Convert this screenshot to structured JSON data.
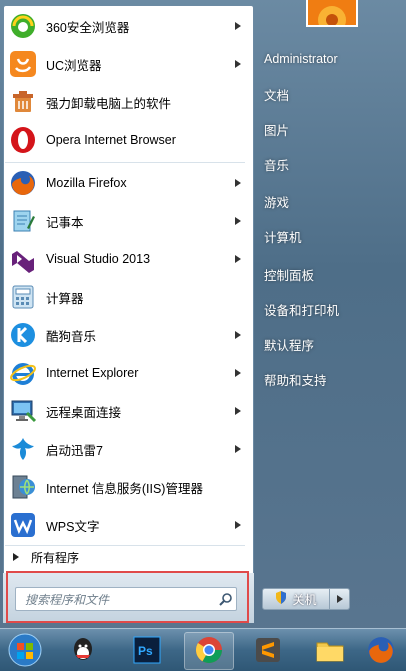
{
  "start_menu": {
    "pinned_apps": [
      {
        "label": "360安全浏览器",
        "icon": "360-browser-icon",
        "has_arrow": true
      },
      {
        "label": "UC浏览器",
        "icon": "uc-browser-icon",
        "has_arrow": true
      },
      {
        "label": "强力卸载电脑上的软件",
        "icon": "uninstaller-icon",
        "has_arrow": false
      },
      {
        "label": "Opera Internet Browser",
        "icon": "opera-icon",
        "has_arrow": false
      }
    ],
    "recent_apps": [
      {
        "label": "Mozilla Firefox",
        "icon": "firefox-icon",
        "has_arrow": true
      },
      {
        "label": "记事本",
        "icon": "notepad-icon",
        "has_arrow": true
      },
      {
        "label": "Visual Studio 2013",
        "icon": "visual-studio-icon",
        "has_arrow": true
      },
      {
        "label": "计算器",
        "icon": "calculator-icon",
        "has_arrow": false
      },
      {
        "label": "酷狗音乐",
        "icon": "kugou-icon",
        "has_arrow": true
      },
      {
        "label": "Internet Explorer",
        "icon": "internet-explorer-icon",
        "has_arrow": true
      },
      {
        "label": "远程桌面连接",
        "icon": "remote-desktop-icon",
        "has_arrow": true
      },
      {
        "label": "启动迅雷7",
        "icon": "xunlei-icon",
        "has_arrow": true
      },
      {
        "label": "Internet 信息服务(IIS)管理器",
        "icon": "iis-manager-icon",
        "has_arrow": false
      },
      {
        "label": "WPS文字",
        "icon": "wps-icon",
        "has_arrow": true
      }
    ],
    "all_programs_label": "所有程序",
    "search": {
      "placeholder": "搜索程序和文件"
    },
    "right_items": [
      {
        "label": "Administrator"
      },
      {
        "label": "文档"
      },
      {
        "label": "图片"
      },
      {
        "label": "音乐"
      },
      {
        "label": "游戏"
      },
      {
        "label": "计算机"
      },
      {
        "label": "控制面板"
      },
      {
        "label": "设备和打印机"
      },
      {
        "label": "默认程序"
      },
      {
        "label": "帮助和支持"
      }
    ],
    "shutdown_label": "关机"
  },
  "taskbar": {
    "items": [
      "start-orb-icon",
      "qq-icon",
      "photoshop-icon",
      "chrome-icon",
      "sublime-icon",
      "file-explorer-icon",
      "firefox-icon"
    ]
  },
  "colors": {
    "highlight": "#e04a4a",
    "accent": "#3d6787"
  }
}
